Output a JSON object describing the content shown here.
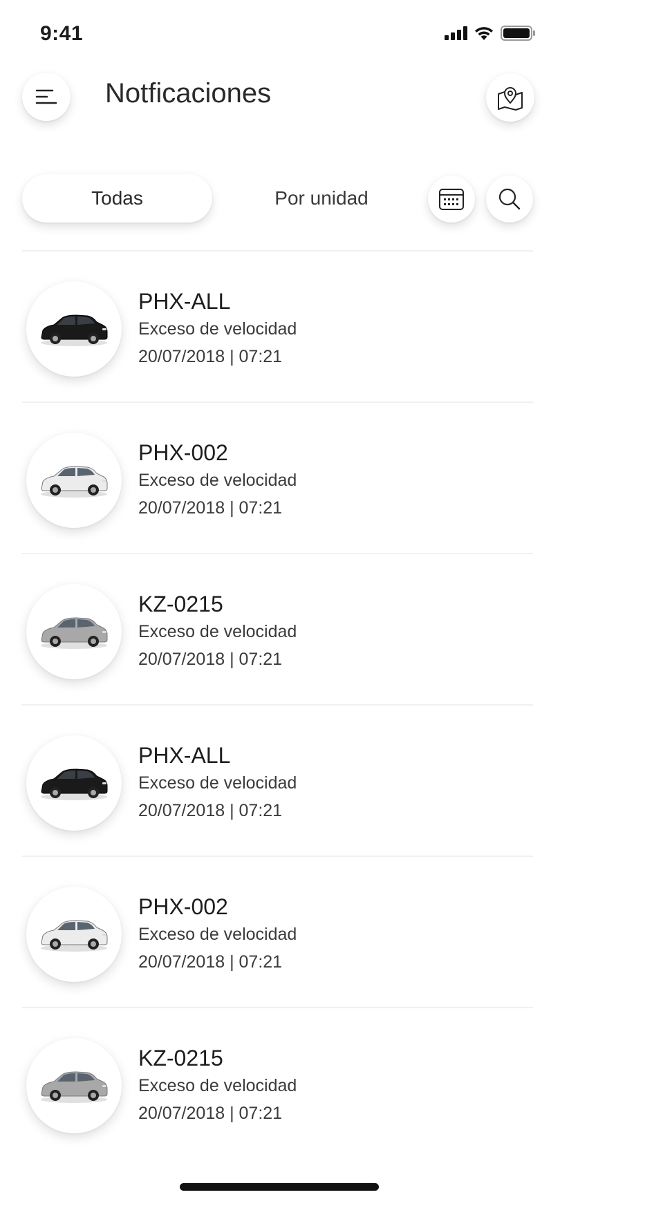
{
  "status_bar": {
    "time": "9:41",
    "icons": [
      "signal-icon",
      "wifi-icon",
      "battery-icon"
    ]
  },
  "header": {
    "title": "Notficaciones",
    "menu_icon": "menu-icon",
    "map_icon": "map-pin-icon"
  },
  "filters": {
    "tabs": [
      {
        "label": "Todas",
        "active": true
      },
      {
        "label": "Por unidad",
        "active": false
      }
    ],
    "calendar_icon": "calendar-icon",
    "search_icon": "search-icon"
  },
  "notifications": [
    {
      "unit": "PHX-ALL",
      "type": "Exceso de velocidad",
      "datetime": "20/07/2018 | 07:21",
      "car_color": "#1a1a1a"
    },
    {
      "unit": "PHX-002",
      "type": "Exceso de velocidad",
      "datetime": "20/07/2018 | 07:21",
      "car_color": "#ececec"
    },
    {
      "unit": "KZ-0215",
      "type": "Exceso de velocidad",
      "datetime": "20/07/2018 | 07:21",
      "car_color": "#a8a8a8"
    },
    {
      "unit": "PHX-ALL",
      "type": "Exceso de velocidad",
      "datetime": "20/07/2018 | 07:21",
      "car_color": "#1a1a1a"
    },
    {
      "unit": "PHX-002",
      "type": "Exceso de velocidad",
      "datetime": "20/07/2018 | 07:21",
      "car_color": "#ececec"
    },
    {
      "unit": "KZ-0215",
      "type": "Exceso de velocidad",
      "datetime": "20/07/2018 | 07:21",
      "car_color": "#a8a8a8"
    }
  ]
}
